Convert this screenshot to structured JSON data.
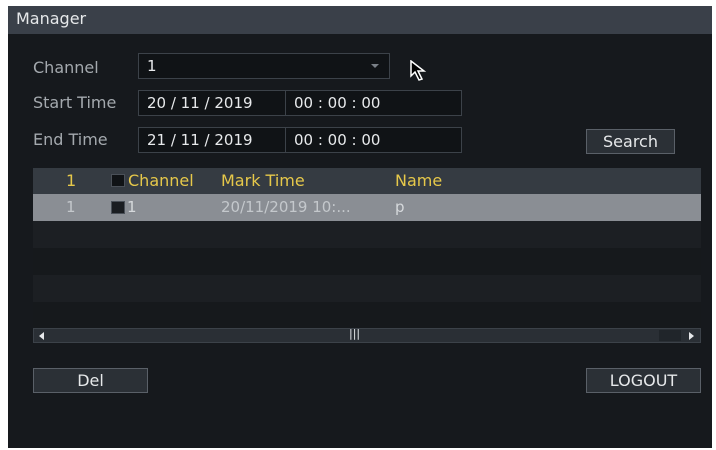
{
  "window": {
    "title": "Manager"
  },
  "form": {
    "channel_label": "Channel",
    "channel_value": "1",
    "start_label": "Start Time",
    "start_date": "20 / 11 / 2019",
    "start_time": "00 : 00 : 00",
    "end_label": "End Time",
    "end_date": "21 / 11 / 2019",
    "end_time": "00 : 00 : 00",
    "search_button": "Search"
  },
  "table": {
    "header": {
      "index": "1",
      "channel": "Channel",
      "mark_time": "Mark Time",
      "name": "Name"
    },
    "rows": [
      {
        "index": "1",
        "channel": "1",
        "mark_time": "20/11/2019 10:...",
        "name": "p",
        "selected": true
      }
    ],
    "scroll_thumb": "|||"
  },
  "footer": {
    "del_button": "Del",
    "logout_button": "LOGOUT"
  },
  "colors": {
    "background": "#16191d",
    "titlebar": "#3a4049",
    "header_text": "#e6c84a",
    "selected_row": "#8a8e94"
  }
}
